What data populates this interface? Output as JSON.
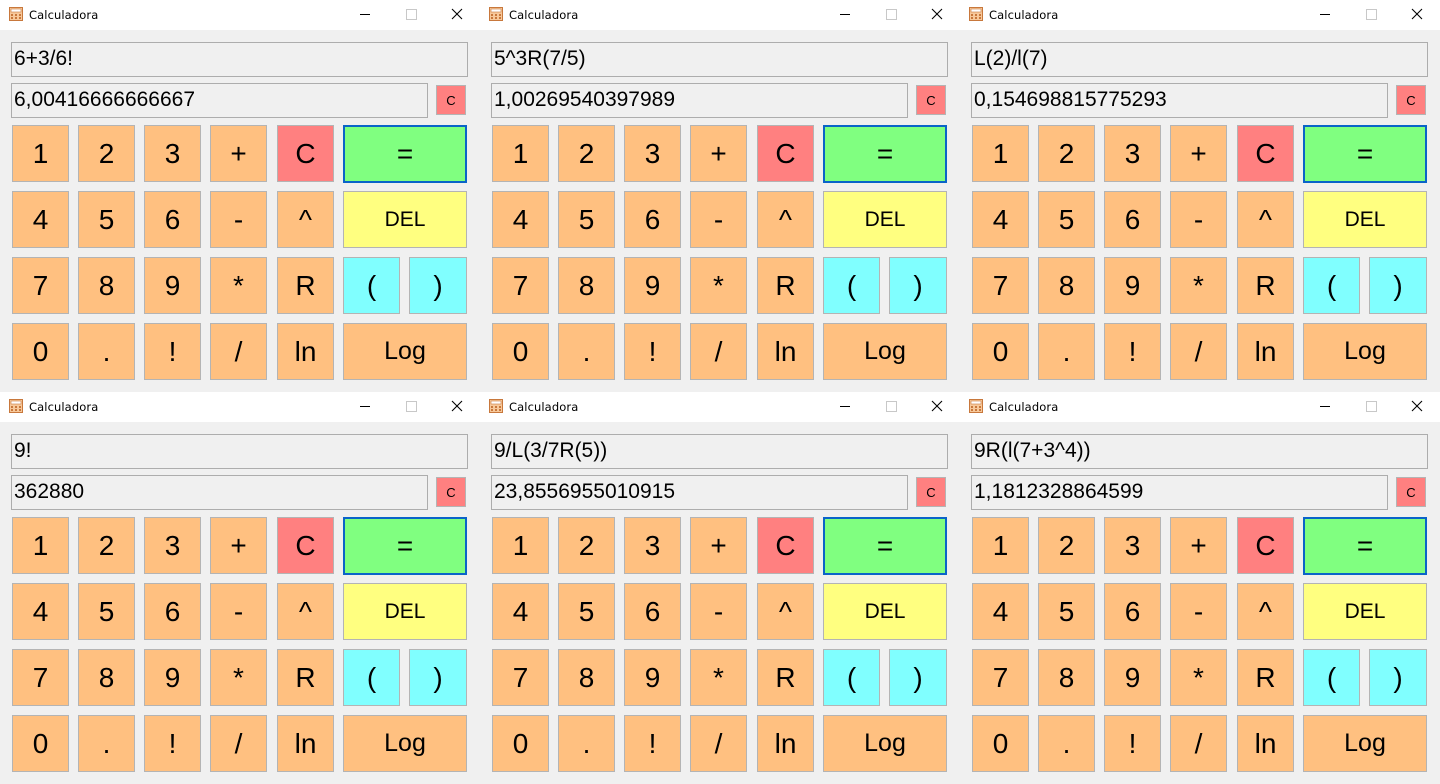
{
  "app_title": "Calculadora",
  "titlebar_buttons": {
    "minimize_icon": "minimize-icon",
    "maximize_icon": "maximize-icon",
    "close_icon": "close-icon"
  },
  "windows": [
    {
      "expression": "6+3/6!",
      "result": "6,00416666666667"
    },
    {
      "expression": "5^3R(7/5)",
      "result": "1,00269540397989"
    },
    {
      "expression": "L(2)/l(7)",
      "result": "0,154698815775293"
    },
    {
      "expression": "9!",
      "result": "362880"
    },
    {
      "expression": "9/L(3/7R(5))",
      "result": "23,8556955010915"
    },
    {
      "expression": "9R(l(7+3^4))",
      "result": "1,1812328864599"
    }
  ],
  "small_clear_label": "C",
  "keypad": [
    {
      "key": "1",
      "label": "1",
      "style": "orange"
    },
    {
      "key": "2",
      "label": "2",
      "style": "orange"
    },
    {
      "key": "3",
      "label": "3",
      "style": "orange"
    },
    {
      "key": "plus",
      "label": "+",
      "style": "orange"
    },
    {
      "key": "clear",
      "label": "C",
      "style": "red"
    },
    {
      "key": "equals",
      "label": "=",
      "style": "green"
    },
    {
      "key": "4",
      "label": "4",
      "style": "orange"
    },
    {
      "key": "5",
      "label": "5",
      "style": "orange"
    },
    {
      "key": "6",
      "label": "6",
      "style": "orange"
    },
    {
      "key": "minus",
      "label": "-",
      "style": "orange"
    },
    {
      "key": "power",
      "label": "^",
      "style": "orange"
    },
    {
      "key": "del",
      "label": "DEL",
      "style": "yellow"
    },
    {
      "key": "7",
      "label": "7",
      "style": "orange"
    },
    {
      "key": "8",
      "label": "8",
      "style": "orange"
    },
    {
      "key": "9",
      "label": "9",
      "style": "orange"
    },
    {
      "key": "multiply",
      "label": "*",
      "style": "orange"
    },
    {
      "key": "root",
      "label": "R",
      "style": "orange"
    },
    {
      "key": "open-paren",
      "label": "(",
      "style": "cyan"
    },
    {
      "key": "close-paren",
      "label": ")",
      "style": "cyan"
    },
    {
      "key": "0",
      "label": "0",
      "style": "orange"
    },
    {
      "key": "decimal",
      "label": ".",
      "style": "orange"
    },
    {
      "key": "factorial",
      "label": "!",
      "style": "orange"
    },
    {
      "key": "divide",
      "label": "/",
      "style": "orange"
    },
    {
      "key": "ln",
      "label": "ln",
      "style": "orange"
    },
    {
      "key": "log",
      "label": "Log",
      "style": "orange"
    }
  ],
  "colors": {
    "orange": "#ffc080",
    "red": "#ff8080",
    "green": "#80ff80",
    "yellow": "#ffff80",
    "cyan": "#80ffff",
    "window_bg": "#f0f0f0",
    "focus_border": "#0a64c8"
  }
}
